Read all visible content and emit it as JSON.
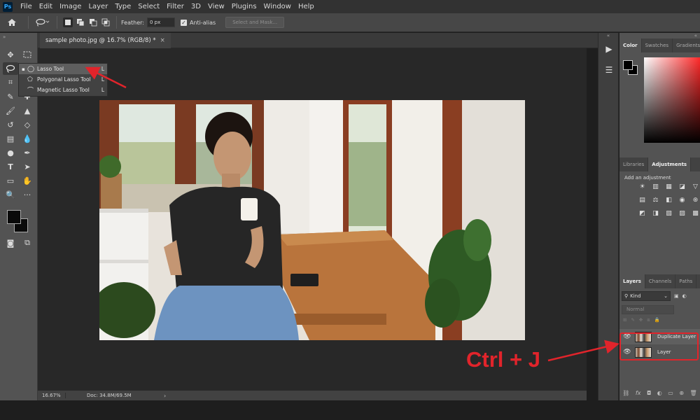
{
  "menubar": {
    "logo": "Ps",
    "items": [
      "File",
      "Edit",
      "Image",
      "Layer",
      "Type",
      "Select",
      "Filter",
      "3D",
      "View",
      "Plugins",
      "Window",
      "Help"
    ]
  },
  "options": {
    "feather_label": "Feather:",
    "feather_value": "0 px",
    "antialias_label": "Anti-alias",
    "select_mask_label": "Select and Mask..."
  },
  "document": {
    "tab_title": "sample photo.jpg @ 16.7% (RGB/8) *",
    "close_symbol": "×"
  },
  "flyout": {
    "items": [
      {
        "label": "Lasso Tool",
        "key": "L",
        "active": true,
        "icon": "lasso-icon"
      },
      {
        "label": "Polygonal Lasso Tool",
        "key": "L",
        "active": false,
        "icon": "polygonal-lasso-icon"
      },
      {
        "label": "Magnetic Lasso Tool",
        "key": "L",
        "active": false,
        "icon": "magnetic-lasso-icon"
      }
    ]
  },
  "status": {
    "zoom": "16.67%",
    "doc": "Doc: 34.8M/69.5M",
    "arrow": "›"
  },
  "panels": {
    "color_tabs": [
      "Color",
      "Swatches",
      "Gradients"
    ],
    "adjust_tabs": [
      "Libraries",
      "Adjustments"
    ],
    "add_adjustment": "Add an adjustment",
    "layers_tabs": [
      "Layers",
      "Channels",
      "Paths"
    ],
    "kind_label": "Kind",
    "blend_mode": "Normal",
    "layers": [
      {
        "name": "Duplicate Layer",
        "selected": true
      },
      {
        "name": "Layer",
        "selected": false
      }
    ]
  },
  "annotation": {
    "shortcut": "Ctrl + J",
    "color": "#e1242b"
  }
}
